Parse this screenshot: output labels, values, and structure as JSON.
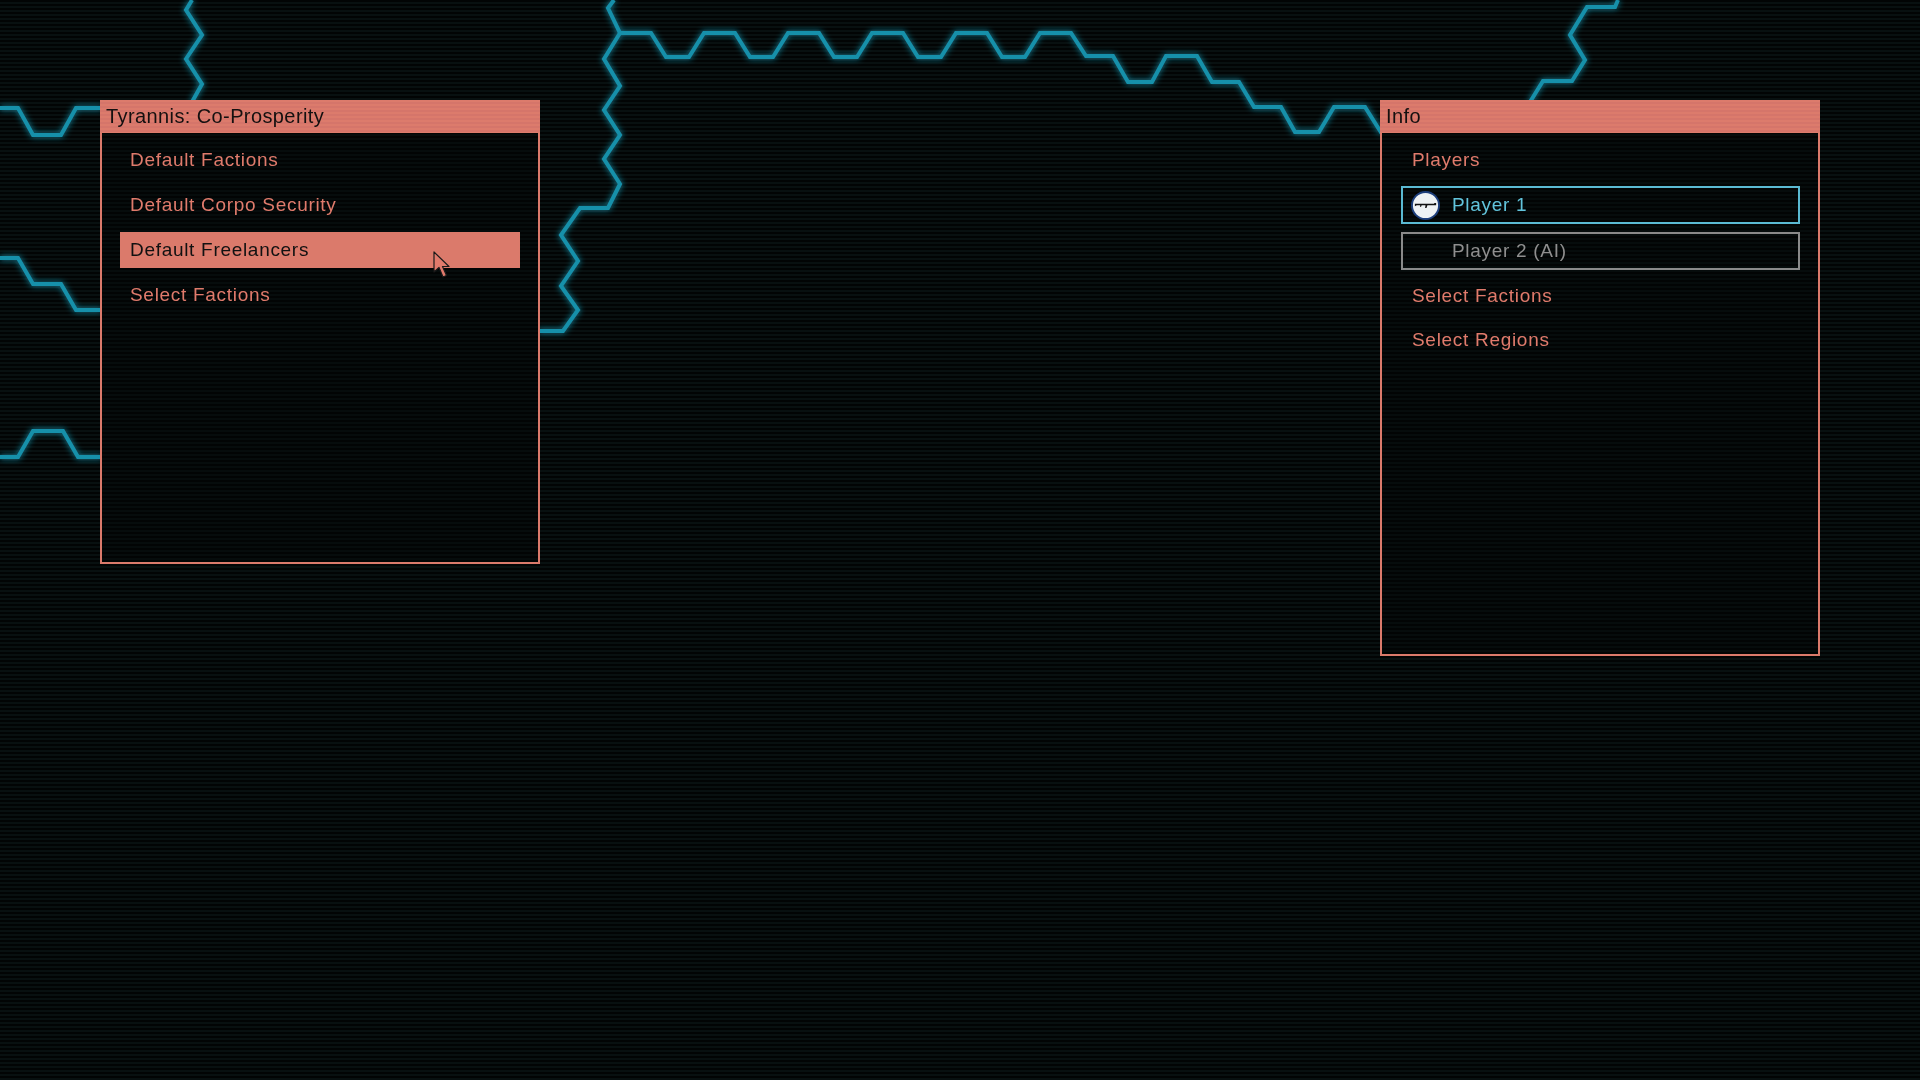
{
  "setup_panel": {
    "title": "Tyrannis: Co-Prosperity",
    "items": [
      {
        "label": "Default Factions",
        "selected": false
      },
      {
        "label": "Default Corpo Security",
        "selected": false
      },
      {
        "label": "Default Freelancers",
        "selected": true
      },
      {
        "label": "Select Factions",
        "selected": false
      }
    ]
  },
  "info_panel": {
    "title": "Info",
    "items": [
      {
        "kind": "option",
        "label": "Players",
        "selected": false
      },
      {
        "kind": "player",
        "label": "Player 1",
        "selected": true,
        "emblem": true
      },
      {
        "kind": "player",
        "label": "Player 2 (AI)",
        "selected": false,
        "emblem": false
      },
      {
        "kind": "option",
        "label": "Select Factions",
        "selected": false
      },
      {
        "kind": "option",
        "label": "Select Regions",
        "selected": false
      }
    ]
  }
}
